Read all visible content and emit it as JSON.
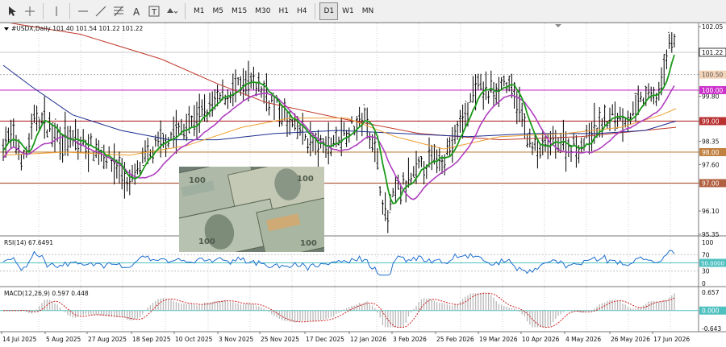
{
  "toolbar": {
    "tools": [
      {
        "name": "cursor-icon",
        "glyph": "arrow"
      },
      {
        "name": "crosshair-icon",
        "glyph": "cross"
      },
      {
        "name": "vertical-line-icon",
        "glyph": "vline"
      },
      {
        "name": "horizontal-line-icon",
        "glyph": "hline"
      },
      {
        "name": "trendline-icon",
        "glyph": "trend"
      },
      {
        "name": "fibonacci-icon",
        "glyph": "fib"
      },
      {
        "name": "text-icon",
        "glyph": "A"
      },
      {
        "name": "text-label-icon",
        "glyph": "T"
      },
      {
        "name": "shapes-dropdown-icon",
        "glyph": "shapes"
      }
    ],
    "timeframes": [
      "M1",
      "M5",
      "M15",
      "M30",
      "H1",
      "H4",
      "D1",
      "W1",
      "MN"
    ],
    "active_timeframe": "D1"
  },
  "chart": {
    "header": "#USDX,Daily  101.40 101.54 101.22 101.22",
    "price_axis": [
      "102.05",
      "101.22",
      "100.50",
      "100.00",
      "99.80",
      "99.00",
      "98.35",
      "98.00",
      "97.60",
      "97.00",
      "96.10",
      "95.35"
    ],
    "x_axis": [
      "14 Jul 2025",
      "5 Aug 2025",
      "27 Aug 2025",
      "18 Sep 2025",
      "10 Oct 2025",
      "3 Nov 2025",
      "25 Nov 2025",
      "17 Dec 2025",
      "12 Jan 2026",
      "3 Feb 2026",
      "25 Feb 2026",
      "19 Mar 2026",
      "10 Apr 2026",
      "4 May 2026",
      "26 May 2026",
      "17 Jun 2026"
    ],
    "levels": [
      {
        "label": "100.00",
        "value": 100.0,
        "color": "#cc33cc"
      },
      {
        "label": "99.00",
        "value": 99.0,
        "color": "#b83030"
      },
      {
        "label": "98.00",
        "value": 98.0,
        "color": "#c08040"
      },
      {
        "label": "97.00",
        "value": 97.0,
        "color": "#b06040"
      }
    ],
    "level_dotted": {
      "label": "100.50",
      "value": 100.5
    },
    "current_price": "101.22",
    "rsi": {
      "label": "RSI(14) 67.6491",
      "axis": [
        "100",
        "70",
        "50.0000",
        "30",
        "0"
      ]
    },
    "macd": {
      "label": "MACD(12,26,9) 0.597 0.448",
      "axis": [
        "0.657",
        "0.000",
        "-0.643"
      ]
    }
  }
}
